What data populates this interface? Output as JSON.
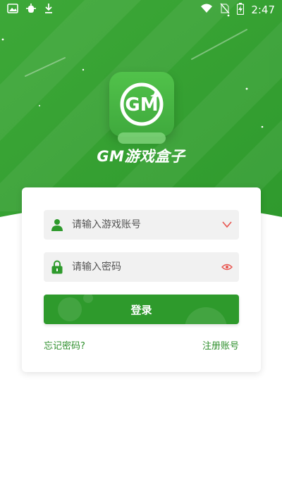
{
  "status_bar": {
    "time": "2:47",
    "left_icons": [
      "image-icon",
      "bug-icon",
      "download-icon"
    ],
    "right_icons": [
      "wifi-icon",
      "no-sim-icon",
      "battery-charging-icon"
    ]
  },
  "app": {
    "title": "GM游戏盒子",
    "logo_text": "GM"
  },
  "login_form": {
    "account_placeholder": "请输入游戏账号",
    "password_placeholder": "请输入密码",
    "login_label": "登录",
    "forgot_password": "忘记密码?",
    "register": "注册账号"
  },
  "colors": {
    "brand_green": "#2e9a2c",
    "hero_green": "#3aa336",
    "field_bg": "#f1f1f1",
    "accent_red": "#e8544e"
  }
}
